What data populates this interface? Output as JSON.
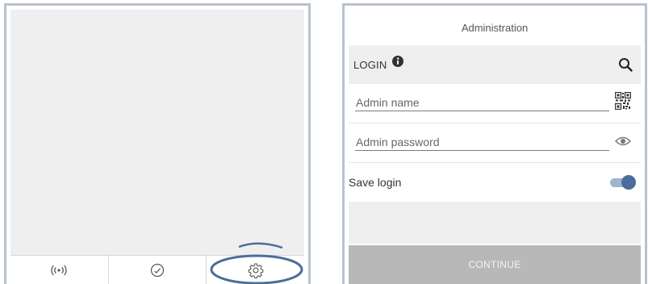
{
  "left_screen": {
    "tabs": [
      {
        "icon": "broadcast-icon"
      },
      {
        "icon": "clock-icon"
      },
      {
        "icon": "gear-icon",
        "highlighted": true
      }
    ],
    "highlight_color": "#4a6d9c"
  },
  "admin_screen": {
    "title": "Administration",
    "login_section": {
      "label": "LOGIN",
      "info_icon": "info-icon",
      "search_icon": "search-icon"
    },
    "fields": {
      "admin_name": {
        "placeholder": "Admin name",
        "value": "",
        "trailing_icon": "qr-code-icon"
      },
      "admin_password": {
        "placeholder": "Admin password",
        "value": "",
        "trailing_icon": "eye-icon"
      }
    },
    "save_login": {
      "label": "Save login",
      "enabled": true
    },
    "continue_label": "CONTINUE"
  },
  "colors": {
    "accent": "#4a6d9c",
    "toggle_track": "#9eb5cf",
    "frame": "#b9c2cc",
    "panel_bg": "#efeff0",
    "disabled_button": "#b8b8b8"
  }
}
